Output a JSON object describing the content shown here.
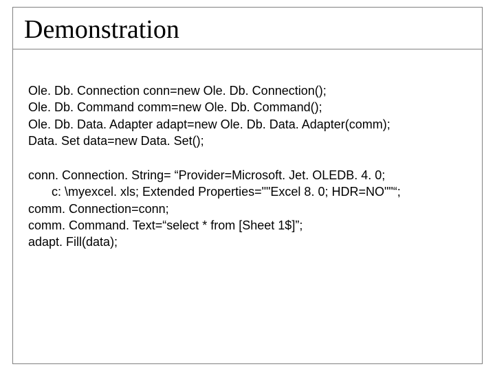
{
  "title": "Demonstration",
  "code": {
    "block1": [
      "Ole. Db. Connection conn=new Ole. Db. Connection();",
      "Ole. Db. Command comm=new Ole. Db. Command();",
      "Ole. Db. Data. Adapter adapt=new Ole. Db. Data. Adapter(comm);",
      "Data. Set data=new Data. Set();"
    ],
    "block2_line1": "conn. Connection. String= “Provider=Microsoft. Jet. OLEDB. 4. 0;",
    "block2_indent": "c: \\myexcel. xls; Extended Properties=\"\"Excel 8. 0; HDR=NO\"\"“;",
    "block2_rest": [
      "comm. Connection=conn;",
      "comm. Command. Text=“select * from [Sheet 1$]”;",
      "adapt. Fill(data);"
    ]
  }
}
